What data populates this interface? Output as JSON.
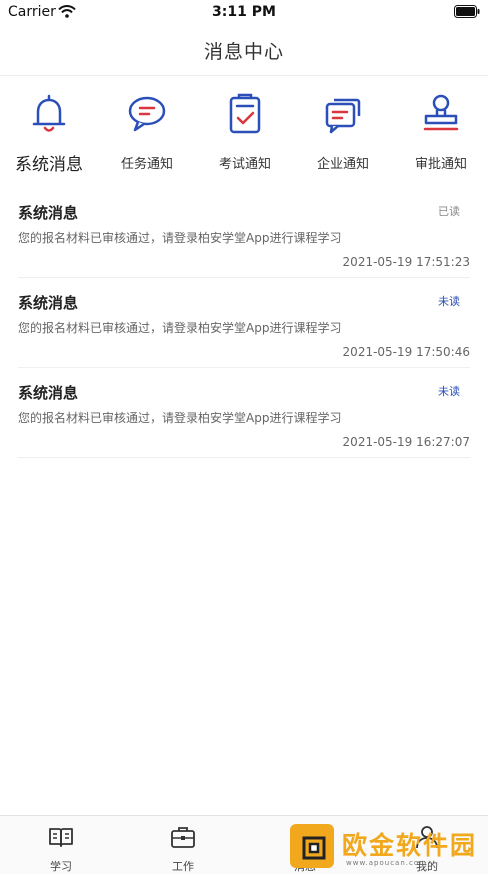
{
  "status_bar": {
    "carrier": "Carrier",
    "time": "3:11 PM"
  },
  "nav": {
    "title": "消息中心"
  },
  "categories": [
    {
      "label": "系统消息",
      "icon": "bell-icon",
      "active": true
    },
    {
      "label": "任务通知",
      "icon": "chat-bubble-icon",
      "active": false
    },
    {
      "label": "考试通知",
      "icon": "checklist-icon",
      "active": false
    },
    {
      "label": "企业通知",
      "icon": "messages-icon",
      "active": false
    },
    {
      "label": "审批通知",
      "icon": "stamp-icon",
      "active": false
    }
  ],
  "messages": [
    {
      "title": "系统消息",
      "status": "已读",
      "read": true,
      "body": "您的报名材料已审核通过，请登录柏安学堂App进行课程学习",
      "time": "2021-05-19 17:51:23"
    },
    {
      "title": "系统消息",
      "status": "未读",
      "read": false,
      "body": "您的报名材料已审核通过，请登录柏安学堂App进行课程学习",
      "time": "2021-05-19 17:50:46"
    },
    {
      "title": "系统消息",
      "status": "未读",
      "read": false,
      "body": "您的报名材料已审核通过，请登录柏安学堂App进行课程学习",
      "time": "2021-05-19 16:27:07"
    }
  ],
  "tabs": [
    {
      "label": "学习",
      "icon": "book-icon"
    },
    {
      "label": "工作",
      "icon": "briefcase-icon"
    },
    {
      "label": "消息",
      "icon": "message-icon"
    },
    {
      "label": "我的",
      "icon": "profile-icon"
    }
  ],
  "watermark": {
    "text": "欧金软件园",
    "url": "www.apoucan.com"
  },
  "colors": {
    "accent_blue": "#2a4fb8",
    "accent_red": "#d9363e",
    "watermark_orange": "#f2a81d"
  }
}
